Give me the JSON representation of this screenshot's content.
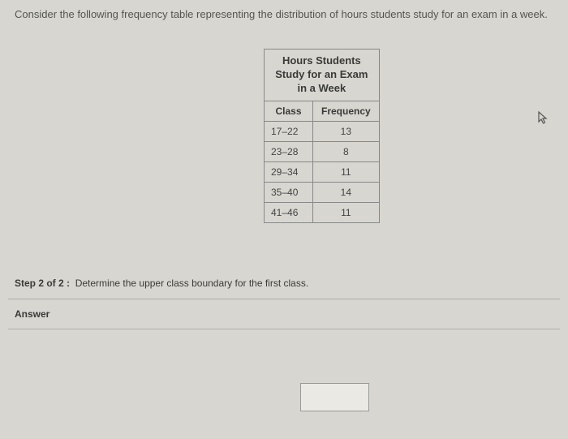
{
  "question": "Consider the following frequency table representing the distribution of hours students study for an exam in a week.",
  "table": {
    "title_line1": "Hours Students",
    "title_line2": "Study for an Exam",
    "title_line3": "in a Week",
    "header_class": "Class",
    "header_frequency": "Frequency",
    "rows": [
      {
        "class": "17–22",
        "frequency": "13"
      },
      {
        "class": "23–28",
        "frequency": "8"
      },
      {
        "class": "29–34",
        "frequency": "11"
      },
      {
        "class": "35–40",
        "frequency": "14"
      },
      {
        "class": "41–46",
        "frequency": "11"
      }
    ]
  },
  "step": {
    "label": "Step 2 of 2 :",
    "instruction": "Determine the upper class boundary for the first class."
  },
  "answer_label": "Answer",
  "answer_value": "",
  "chart_data": {
    "type": "table",
    "title": "Hours Students Study for an Exam in a Week",
    "columns": [
      "Class",
      "Frequency"
    ],
    "rows": [
      [
        "17–22",
        13
      ],
      [
        "23–28",
        8
      ],
      [
        "29–34",
        11
      ],
      [
        "35–40",
        14
      ],
      [
        "41–46",
        11
      ]
    ]
  }
}
